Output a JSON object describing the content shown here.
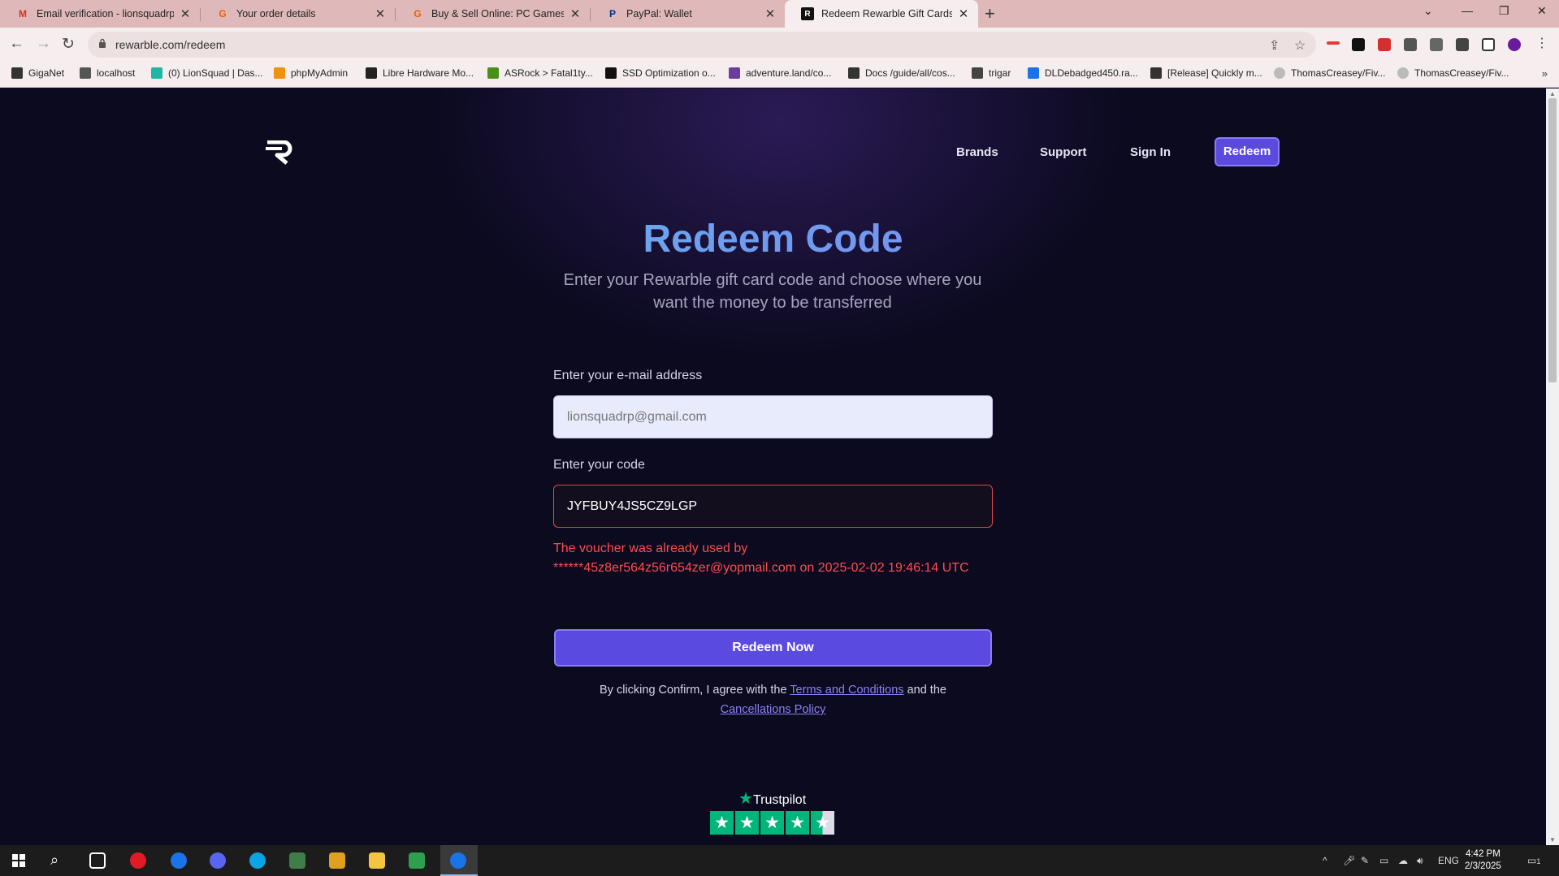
{
  "browser": {
    "tabs": [
      {
        "title": "Email verification - lionsquadrp@",
        "icon": "gmail-icon",
        "color": "#d93025"
      },
      {
        "title": "Your order details",
        "icon": "g2a-icon",
        "color": "#f05f00"
      },
      {
        "title": "Buy & Sell Online: PC Games, So",
        "icon": "g2a-icon",
        "color": "#f05f00"
      },
      {
        "title": "PayPal: Wallet",
        "icon": "paypal-icon",
        "color": "#003087"
      },
      {
        "title": "Redeem Rewarble Gift Cards | Se",
        "icon": "rewarble-icon",
        "color": "#111111"
      }
    ],
    "url": "rewarble.com/redeem",
    "bookmarks": [
      {
        "label": "GigaNet",
        "color": "#333333"
      },
      {
        "label": "localhost",
        "color": "#555555"
      },
      {
        "label": "(0) LionSquad | Das...",
        "color": "#1fb6a6"
      },
      {
        "label": "phpMyAdmin",
        "color": "#f29111"
      },
      {
        "label": "Libre Hardware Mo...",
        "color": "#222222"
      },
      {
        "label": "ASRock > Fatal1ty...",
        "color": "#4a8f1a"
      },
      {
        "label": "SSD Optimization o...",
        "color": "#111111"
      },
      {
        "label": "adventure.land/co...",
        "color": "#6a3f9c"
      },
      {
        "label": "Docs /guide/all/cos...",
        "color": "#333333"
      },
      {
        "label": "trigar",
        "color": "#444444"
      },
      {
        "label": "DLDebadged450.ra...",
        "color": "#1a73e8"
      },
      {
        "label": "[Release] Quickly m...",
        "color": "#333333"
      },
      {
        "label": "ThomasCreasey/Fiv...",
        "color": "#bbbbbb"
      },
      {
        "label": "ThomasCreasey/Fiv...",
        "color": "#bbbbbb"
      }
    ]
  },
  "site": {
    "nav": {
      "brands": "Brands",
      "support": "Support",
      "sign_in": "Sign In",
      "redeem": "Redeem"
    },
    "title": "Redeem Code",
    "subtitle": "Enter your Rewarble gift card code and choose where you want the money to be transferred",
    "email_label": "Enter your e-mail address",
    "email_value": "lionsquadrp@gmail.com",
    "code_label": "Enter your code",
    "code_value": "JYFBUY4JS5CZ9LGP",
    "error": "The voucher was already used by ******45z8er564z56r654zer@yopmail.com on 2025-02-02 19:46:14 UTC",
    "cta": "Redeem Now",
    "terms_prefix": "By clicking Confirm, I agree with the",
    "terms_link": "Terms and Conditions",
    "terms_mid": "and the",
    "cancellation_link": "Cancellations Policy",
    "trustpilot": "Trustpilot",
    "trustpilot_rating": 4.5
  },
  "taskbar": {
    "language": "ENG",
    "time": "4:42 PM",
    "date": "2/3/2025",
    "notification_count": "1"
  },
  "colors": {
    "accent": "#5b4ae0",
    "error": "#ff4d4d",
    "trustpilot": "#00b67a"
  }
}
